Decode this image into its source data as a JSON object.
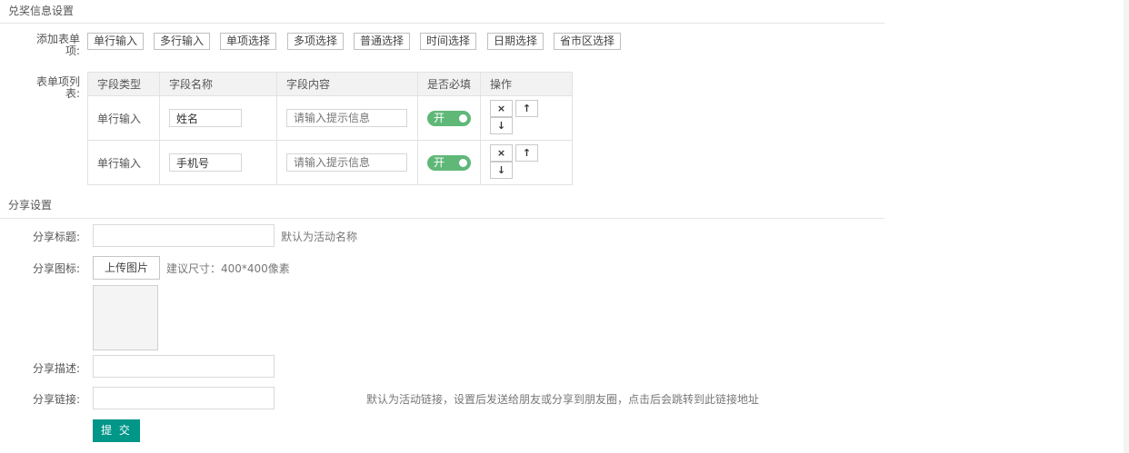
{
  "prize_section": {
    "title": "兑奖信息设置",
    "add_label": "添加表单项:",
    "add_buttons": [
      "单行输入",
      "多行输入",
      "单项选择",
      "多项选择",
      "普通选择",
      "时间选择",
      "日期选择",
      "省市区选择"
    ],
    "list_label": "表单项列表:",
    "table": {
      "headers": [
        "字段类型",
        "字段名称",
        "字段内容",
        "是否必填",
        "操作"
      ],
      "rows": [
        {
          "type": "单行输入",
          "name": "姓名",
          "content_placeholder": "请输入提示信息",
          "required": "开"
        },
        {
          "type": "单行输入",
          "name": "手机号",
          "content_placeholder": "请输入提示信息",
          "required": "开"
        }
      ],
      "op_icons": {
        "delete": "×",
        "up": "↑",
        "down": "↓"
      }
    }
  },
  "share_section": {
    "title": "分享设置",
    "title_label": "分享标题:",
    "title_value": "",
    "title_hint": "默认为活动名称",
    "icon_label": "分享图标:",
    "upload_button": "上传图片",
    "icon_hint": "建议尺寸：400*400像素",
    "desc_label": "分享描述:",
    "desc_value": "",
    "link_label": "分享链接:",
    "link_value": "",
    "link_hint": "默认为活动链接，设置后发送给朋友或分享到朋友圈，点击后会跳转到此链接地址",
    "submit_button": "提 交"
  },
  "colors": {
    "toggle_on": "#5fb878",
    "submit": "#009688"
  }
}
